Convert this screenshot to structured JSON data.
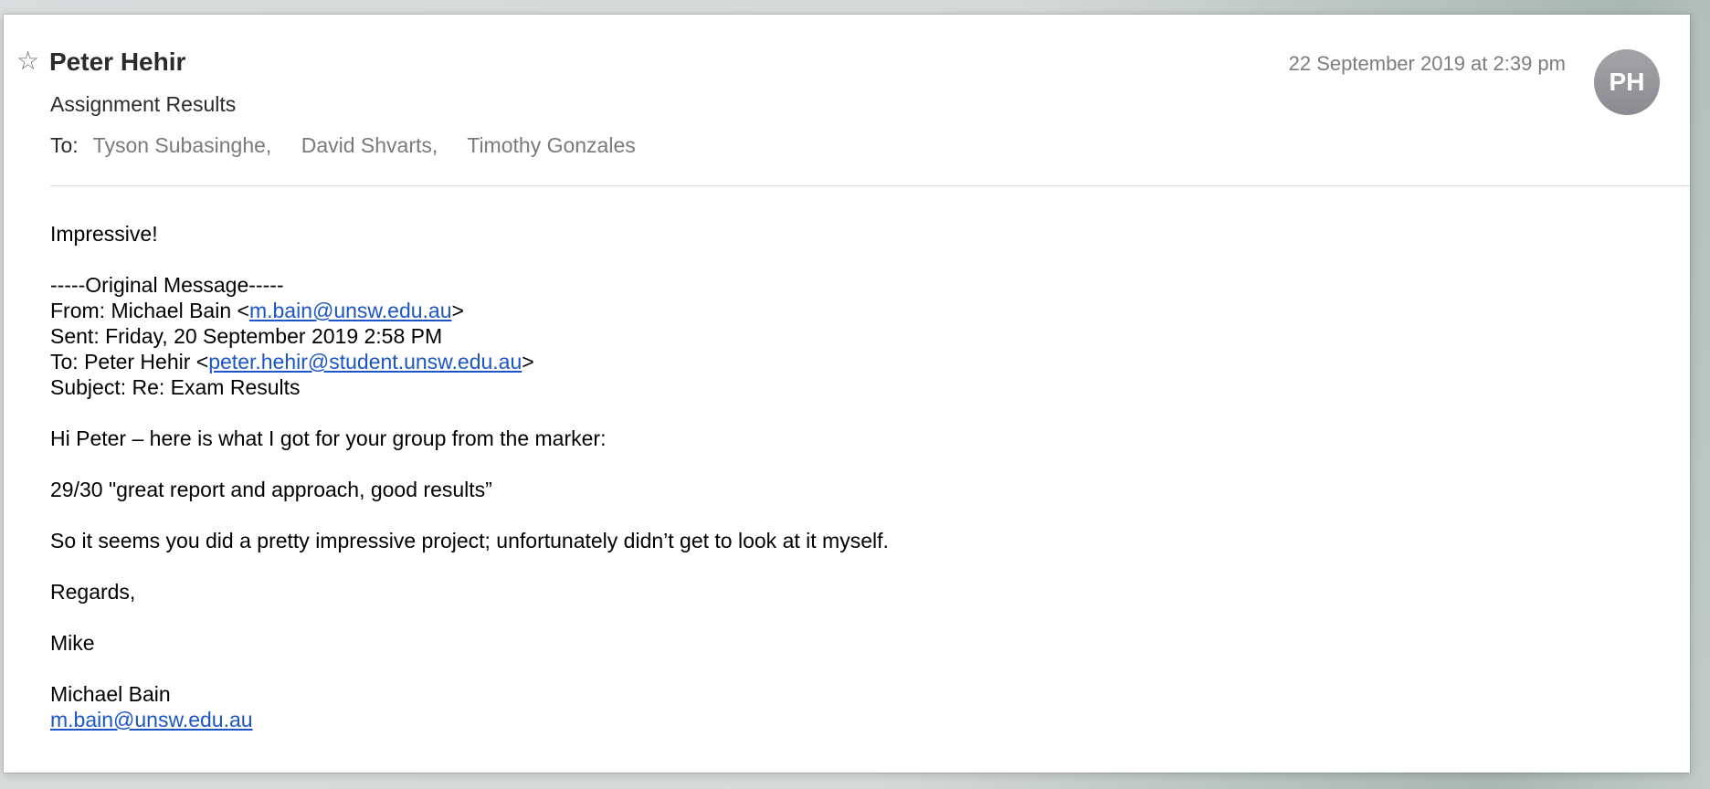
{
  "header": {
    "star_icon": "☆",
    "sender": "Peter Hehir",
    "date": "22 September 2019 at 2:39 pm",
    "avatar_initials": "PH",
    "subject": "Assignment Results",
    "to_label": "To:",
    "recipients": [
      "Tyson Subasinghe",
      "David Shvarts",
      "Timothy Gonzales"
    ],
    "separator": ","
  },
  "body": {
    "greeting": "Impressive!",
    "original_header": "-----Original Message-----",
    "from_prefix": "From: Michael Bain <",
    "from_email": "m.bain@unsw.edu.au",
    "from_suffix": ">",
    "sent": "Sent: Friday, 20 September 2019 2:58 PM",
    "to_prefix": "To: Peter Hehir <",
    "to_email": "peter.hehir@student.unsw.edu.au",
    "to_suffix": ">",
    "subject_line": "Subject: Re: Exam Results",
    "line1": "Hi Peter – here is what I got for your group from the marker:",
    "line2": "29/30 \"great report and approach, good results”",
    "line3": "So it seems you did a pretty impressive project; unfortunately didn’t get to look at it myself.",
    "regards": "Regards,",
    "signoff": "Mike",
    "sig_name": "Michael Bain",
    "sig_email": "m.bain@unsw.edu.au"
  },
  "colors": {
    "link": "#1a56c8",
    "muted": "#7a7a7a",
    "avatar_bg": "#8f9095"
  }
}
